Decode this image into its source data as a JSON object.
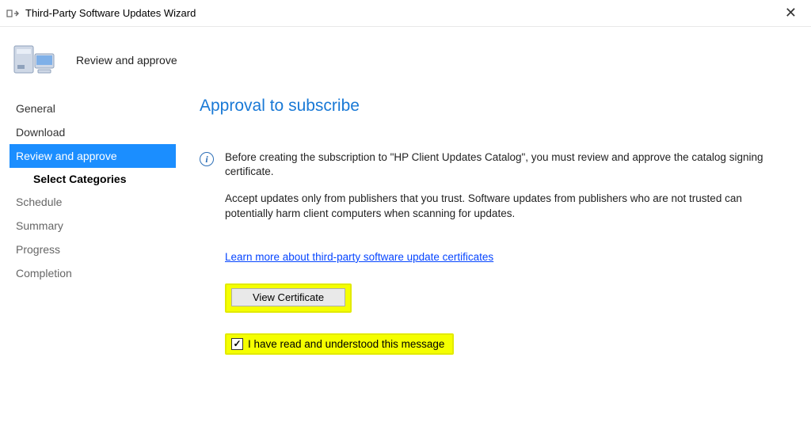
{
  "window": {
    "title": "Third-Party Software Updates Wizard",
    "close_label": "✕"
  },
  "header": {
    "subtitle": "Review and approve"
  },
  "sidebar": {
    "items": [
      {
        "label": "General",
        "state": "done"
      },
      {
        "label": "Download",
        "state": "done"
      },
      {
        "label": "Review and approve",
        "state": "active"
      },
      {
        "label": "Select Categories",
        "state": "sub"
      },
      {
        "label": "Schedule",
        "state": "pending"
      },
      {
        "label": "Summary",
        "state": "pending"
      },
      {
        "label": "Progress",
        "state": "pending"
      },
      {
        "label": "Completion",
        "state": "pending"
      }
    ]
  },
  "main": {
    "page_title": "Approval to subscribe",
    "info_paragraph_1": "Before creating the subscription to \"HP Client Updates Catalog\", you must review and approve the catalog signing certificate.",
    "info_paragraph_2": "Accept updates only from publishers that you trust. Software updates from publishers who are not trusted can potentially harm client computers when scanning for updates.",
    "learn_more_link": "Learn more about third-party software update certificates",
    "view_certificate_label": "View Certificate",
    "checkbox_label": "I have read and understood this message",
    "checkbox_checked_glyph": "✓"
  },
  "icons": {
    "info_glyph": "i"
  }
}
